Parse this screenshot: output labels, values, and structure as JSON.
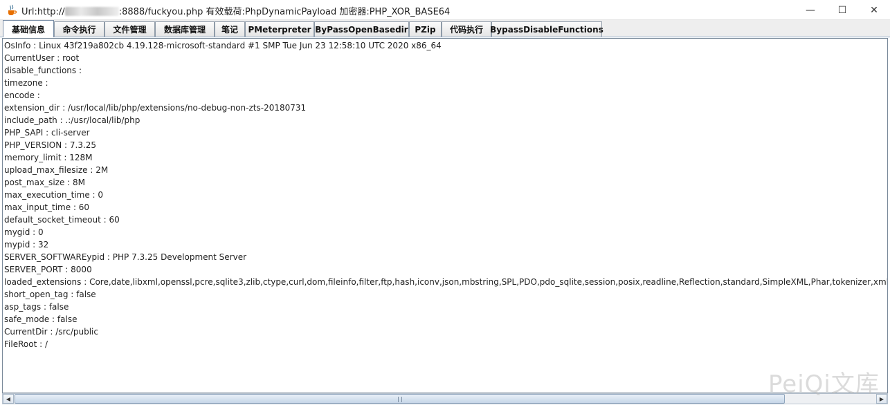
{
  "window": {
    "title_prefix": "Url:http://",
    "title_suffix": ":8888/fuckyou.php 有效载荷:PhpDynamicPayload 加密器:PHP_XOR_BASE64",
    "icon": "java-cup-icon",
    "controls": {
      "minimize": "—",
      "maximize": "☐",
      "close": "✕"
    }
  },
  "tabs": [
    {
      "label": "基础信息",
      "active": true
    },
    {
      "label": "命令执行"
    },
    {
      "label": "文件管理"
    },
    {
      "label": "数据库管理"
    },
    {
      "label": "笔记"
    },
    {
      "label": "PMeterpreter"
    },
    {
      "label": "ByPassOpenBasedir"
    },
    {
      "label": "PZip"
    },
    {
      "label": "代码执行"
    },
    {
      "label": "BypassDisableFunctions"
    }
  ],
  "info_lines": [
    "OsInfo : Linux 43f219a802cb 4.19.128-microsoft-standard #1 SMP Tue Jun 23 12:58:10 UTC 2020 x86_64",
    "CurrentUser : root",
    "disable_functions :",
    "timezone :",
    "encode :",
    "extension_dir : /usr/local/lib/php/extensions/no-debug-non-zts-20180731",
    "include_path : .:/usr/local/lib/php",
    "PHP_SAPI : cli-server",
    "PHP_VERSION : 7.3.25",
    "memory_limit : 128M",
    "upload_max_filesize : 2M",
    "post_max_size : 8M",
    "max_execution_time : 0",
    "max_input_time : 60",
    "default_socket_timeout : 60",
    "mygid : 0",
    "mypid : 32",
    "SERVER_SOFTWAREypid : PHP 7.3.25 Development Server",
    "SERVER_PORT : 8000",
    "loaded_extensions : Core,date,libxml,openssl,pcre,sqlite3,zlib,ctype,curl,dom,fileinfo,filter,ftp,hash,iconv,json,mbstring,SPL,PDO,pdo_sqlite,session,posix,readline,Reflection,standard,SimpleXML,Phar,tokenizer,xml,xmlreader,xmlwriter",
    "short_open_tag : false",
    "asp_tags : false",
    "safe_mode : false",
    "CurrentDir : /src/public",
    "FileRoot : /"
  ],
  "scrollbar": {
    "left_arrow": "◀",
    "right_arrow": "▶"
  },
  "watermark": "PeiQi文库"
}
